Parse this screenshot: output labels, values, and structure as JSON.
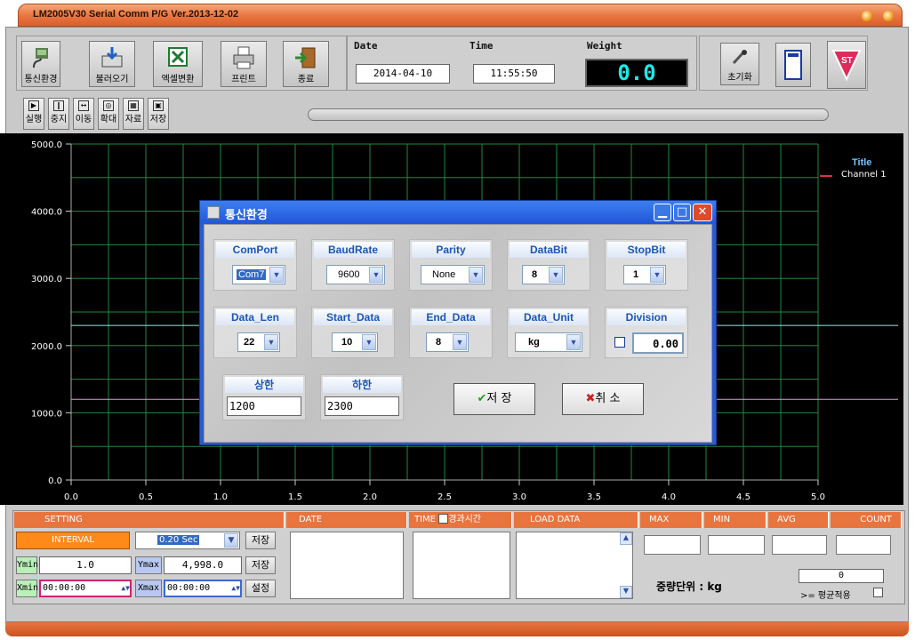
{
  "window": {
    "title": "LM2005V30 Serial Comm P/G Ver.2013-12-02"
  },
  "toolbar": {
    "comm_setup": "통신환경",
    "load": "불러오기",
    "excel": "엑셀변환",
    "print": "프린트",
    "exit": "종료",
    "init": "초기화"
  },
  "info": {
    "date_label": "Date",
    "date_value": "2014-04-10",
    "time_label": "Time",
    "time_value": "11:55:50",
    "weight_label": "Weight",
    "weight_value": "0.0"
  },
  "small_toolbar": {
    "run": "실행",
    "stop": "중지",
    "move": "이동",
    "zoom": "확대",
    "data": "자료",
    "save": "저장"
  },
  "chart_data": {
    "type": "line",
    "y_ticks": [
      "5000.0",
      "4000.0",
      "3000.0",
      "2000.0",
      "1000.0",
      "0.0"
    ],
    "x_ticks": [
      "0.0",
      "0.5",
      "1.0",
      "1.5",
      "2.0",
      "2.5",
      "3.0",
      "3.5",
      "4.0",
      "4.5",
      "5.0"
    ],
    "ylim": [
      0,
      5000
    ],
    "xlim": [
      0,
      5
    ],
    "legend_title": "Title",
    "series": [
      {
        "name": "Channel 1",
        "color": "#e0303a",
        "values": []
      }
    ],
    "reference_lines": [
      {
        "value": 2300,
        "color": "#9fe8e8"
      },
      {
        "value": 1200,
        "color": "#d8a0d8"
      }
    ],
    "grid": true,
    "legend_position": "top-right"
  },
  "dialog": {
    "title": "통신환경",
    "comport_label": "ComPort",
    "comport_value": "Com7",
    "baudrate_label": "BaudRate",
    "baudrate_value": "9600",
    "parity_label": "Parity",
    "parity_value": "None",
    "databit_label": "DataBit",
    "databit_value": "8",
    "stopbit_label": "StopBit",
    "stopbit_value": "1",
    "datalen_label": "Data_Len",
    "datalen_value": "22",
    "startdata_label": "Start_Data",
    "startdata_value": "10",
    "enddata_label": "End_Data",
    "enddata_value": "8",
    "dataunit_label": "Data_Unit",
    "dataunit_value": "kg",
    "division_label": "Division",
    "division_value": "0.00",
    "upper_label": "상한",
    "upper_value": "1200",
    "lower_label": "하한",
    "lower_value": "2300",
    "save_button": "저 장",
    "cancel_button": "취 소"
  },
  "bottom": {
    "setting": "SETTING",
    "interval_label": "INTERVAL",
    "interval_value": "0.20 Sec",
    "interval_save": "저장",
    "ymin_label": "Ymin",
    "ymin_value": "1.0",
    "ymax_label": "Ymax",
    "ymax_value": "4,998.0",
    "ymax_save": "저장",
    "xmin_label": "Xmin",
    "xmin_value": "00:00:00",
    "xmax_label": "Xmax",
    "xmax_value": "00:00:00",
    "apply": "설정",
    "date_header": "DATE",
    "time_header": "TIME",
    "elapsed_label": "경과시간",
    "load_header": "LOAD DATA",
    "max_header": "MAX",
    "min_header": "MIN",
    "avg_header": "AVG",
    "count_header": "COUNT",
    "unit_label": "중량단위 : kg",
    "avg_threshold": "0",
    "avg_apply_label": ">= 평균적용"
  }
}
